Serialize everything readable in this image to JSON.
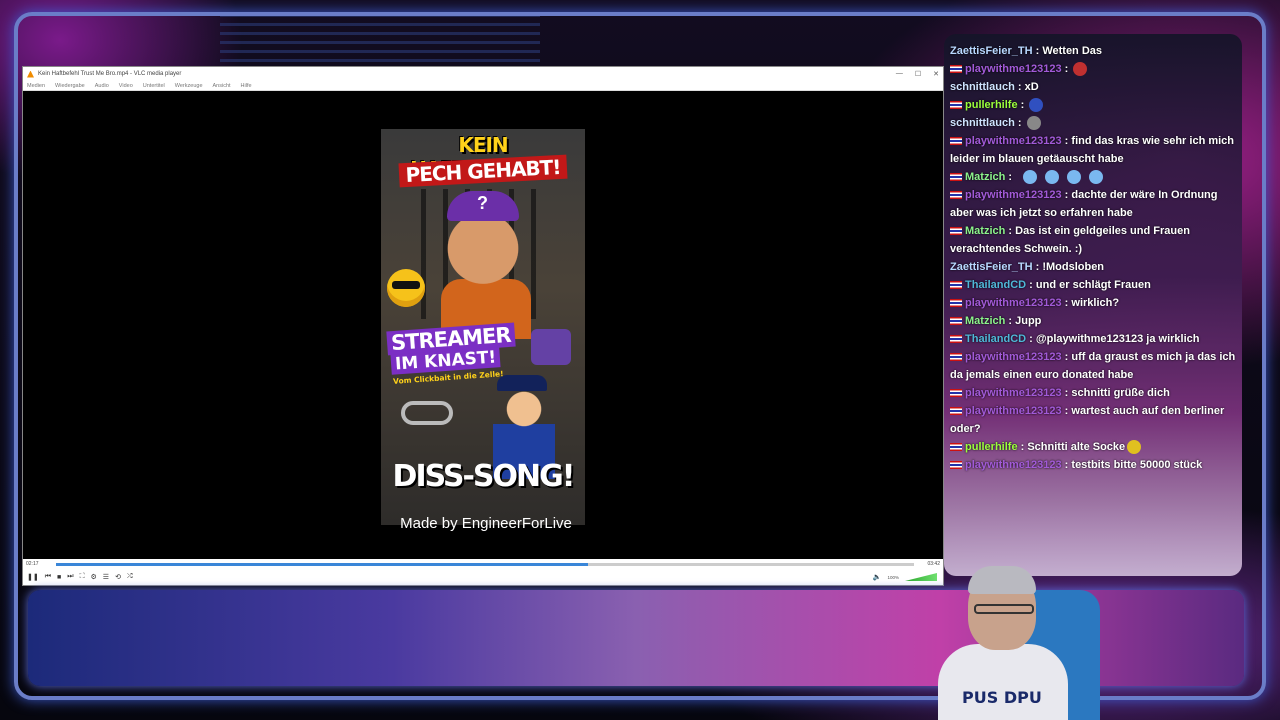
{
  "vlc": {
    "title": "Kein Haftbefehl Trust Me Bro.mp4 - VLC media player",
    "window_buttons": {
      "minimize": "—",
      "maximize": "☐",
      "close": "✕"
    },
    "menu": [
      "Medien",
      "Wiedergabe",
      "Audio",
      "Video",
      "Untertitel",
      "Werkzeuge",
      "Ansicht",
      "Hilfe"
    ],
    "time_elapsed": "02:17",
    "time_total": "03:42",
    "progress_fraction": 0.62,
    "volume_label": "100%",
    "caption": "Made by EngineerForLive"
  },
  "poster": {
    "headline_1": "KEIN HAFTBEFEHL?",
    "headline_2": "PECH GEHABT!",
    "streamer": "STREAMER",
    "knast": "IM KNAST!",
    "tagline": "Vom Clickbait in die Zelle!",
    "diss": "DISS-SONG!"
  },
  "chat": [
    {
      "flag": false,
      "name": "ZaettisFeier_TH",
      "name_class": "n-zae",
      "text": "Wetten Das"
    },
    {
      "flag": true,
      "name": "playwithme123123",
      "name_class": "n-pwm",
      "text": "",
      "emote": "#c03030"
    },
    {
      "flag": false,
      "name": "schnittlauch",
      "name_class": "n-sch",
      "text": "xD"
    },
    {
      "flag": true,
      "name": "pullerhilfe",
      "name_class": "n-pul",
      "text": "",
      "emote": "#3050c0"
    },
    {
      "flag": false,
      "name": "schnittlauch",
      "name_class": "n-sch",
      "text": "",
      "emote": "#888888"
    },
    {
      "flag": true,
      "name": "playwithme123123",
      "name_class": "n-pwm",
      "text": "find das kras wie sehr ich mich leider im blauen getäauscht habe"
    },
    {
      "flag": true,
      "name": "Matzich",
      "name_class": "n-mat",
      "text": "",
      "emote_row": 4
    },
    {
      "flag": true,
      "name": "playwithme123123",
      "name_class": "n-pwm",
      "text": "dachte der wäre In Ordnung aber was ich jetzt so erfahren habe"
    },
    {
      "flag": true,
      "name": "Matzich",
      "name_class": "n-mat",
      "text": "Das ist ein geldgeiles und Frauen verachtendes Schwein. :)"
    },
    {
      "flag": false,
      "name": "ZaettisFeier_TH",
      "name_class": "n-zae",
      "text": "!Modsloben"
    },
    {
      "flag": true,
      "name": "ThailandCD",
      "name_class": "n-tha",
      "text": "und er schlägt Frauen"
    },
    {
      "flag": true,
      "name": "playwithme123123",
      "name_class": "n-pwm",
      "text": "wirklich?"
    },
    {
      "flag": true,
      "name": "Matzich",
      "name_class": "n-mat",
      "text": "Jupp"
    },
    {
      "flag": true,
      "name": "ThailandCD",
      "name_class": "n-tha",
      "text": "@playwithme123123 ja wirklich"
    },
    {
      "flag": true,
      "name": "playwithme123123",
      "name_class": "n-pwm",
      "text": "uff da graust es mich ja das ich da jemals einen euro donated habe"
    },
    {
      "flag": true,
      "name": "playwithme123123",
      "name_class": "n-pwm",
      "text": "schnitti grüße dich"
    },
    {
      "flag": true,
      "name": "playwithme123123",
      "name_class": "n-pwm",
      "text": "wartest auch auf den berliner oder?"
    },
    {
      "flag": true,
      "name": "pullerhilfe",
      "name_class": "n-pul",
      "text": "Schnitti alte Socke",
      "emote": "#e0c020"
    },
    {
      "flag": true,
      "name": "playwithme123123",
      "name_class": "n-pwm",
      "text": "testbits bitte 50000 stück"
    }
  ],
  "streamer_shirt": "PUS DPU",
  "colors": {
    "accent_frame": "#6a7dc8",
    "seek": "#3a86d8",
    "twitch": "#6441a5"
  }
}
